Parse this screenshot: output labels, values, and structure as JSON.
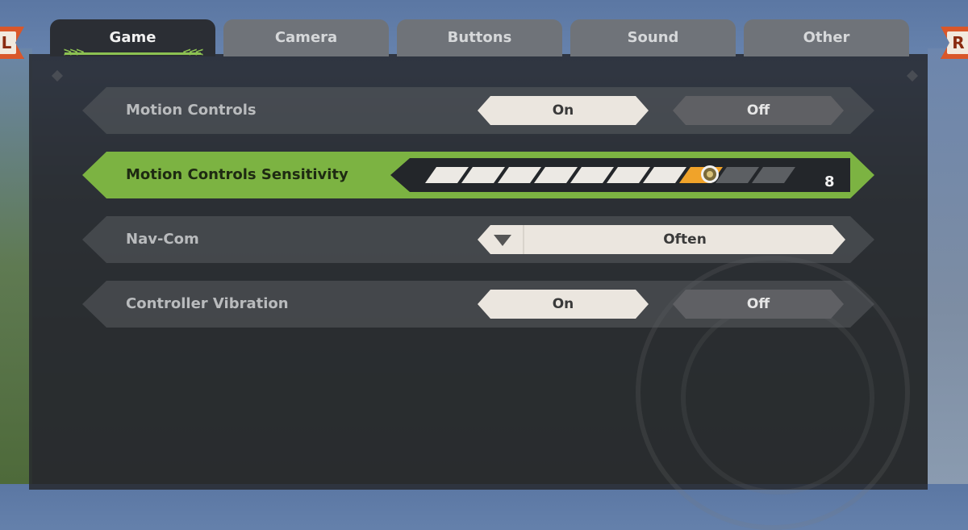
{
  "tabs": [
    {
      "label": "Game",
      "active": true
    },
    {
      "label": "Camera",
      "active": false
    },
    {
      "label": "Buttons",
      "active": false
    },
    {
      "label": "Sound",
      "active": false
    },
    {
      "label": "Other",
      "active": false
    }
  ],
  "shoulder": {
    "left": "L",
    "right": "R"
  },
  "settings": {
    "motion_controls": {
      "label": "Motion Controls",
      "on": "On",
      "off": "Off",
      "selected": "On"
    },
    "sensitivity": {
      "label": "Motion Controls Sensitivity",
      "value": "8",
      "max": 10
    },
    "nav_com": {
      "label": "Nav-Com",
      "value": "Often"
    },
    "vibration": {
      "label": "Controller Vibration",
      "on": "On",
      "off": "Off",
      "selected": "On"
    }
  }
}
